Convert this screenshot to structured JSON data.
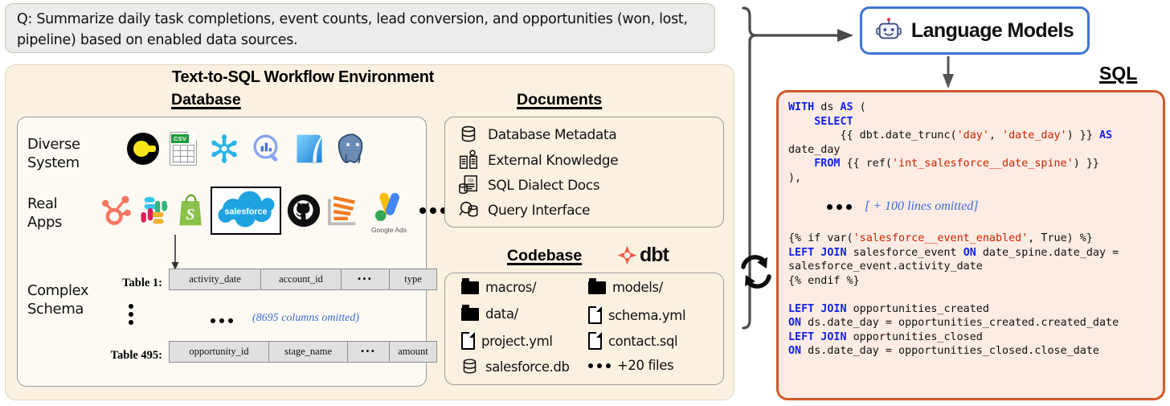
{
  "question": {
    "label": "Q:",
    "text": "Q: Summarize daily task completions, event counts, lead conversion, and opportunities (won, lost, pipeline) based on enabled data sources."
  },
  "environment": {
    "title": "Text-to-SQL Workflow Environment",
    "database": {
      "heading": "Database",
      "rows": [
        {
          "label": "Diverse\nSystem",
          "label_line1": "Diverse",
          "label_line2": "System",
          "icons": [
            "duckdb-icon",
            "csv-file-icon",
            "snowflake-icon",
            "bigquery-icon",
            "sqlite-icon",
            "postgresql-icon"
          ]
        },
        {
          "label": "Real\nApps",
          "label_line1": "Real",
          "label_line2": "Apps",
          "icons": [
            "hubspot-icon",
            "slack-icon",
            "shopify-icon",
            "salesforce-icon",
            "github-icon",
            "asana-icon",
            "google-ads-icon",
            "ellipsis-icon"
          ],
          "salesforce_label": "salesforce",
          "google_ads_label": "Google Ads"
        },
        {
          "label": "Complex\nSchema",
          "label_line1": "Complex",
          "label_line2": "Schema"
        }
      ],
      "tables": [
        {
          "name": "Table 1:",
          "columns": [
            "activity_date",
            "account_id",
            "•••",
            "type"
          ]
        },
        {
          "name": "Table 495:",
          "columns": [
            "opportunity_id",
            "stage_name",
            "•••",
            "amount"
          ]
        }
      ],
      "omitted_note": "(8695 columns omitted)"
    },
    "documents": {
      "heading": "Documents",
      "items": [
        {
          "icon": "database-cylinder-icon",
          "label": "Database Metadata"
        },
        {
          "icon": "open-book-bulb-icon",
          "label": "External Knowledge"
        },
        {
          "icon": "sql-doc-icon",
          "label": "SQL Dialect Docs"
        },
        {
          "icon": "magnifier-database-icon",
          "label": "Query Interface"
        }
      ]
    },
    "codebase": {
      "heading": "Codebase",
      "logo_label": "dbt",
      "items_left": [
        {
          "icon": "folder-icon",
          "label": "macros/"
        },
        {
          "icon": "folder-icon",
          "label": "data/"
        },
        {
          "icon": "file-icon",
          "label": "project.yml"
        },
        {
          "icon": "database-cylinder-icon",
          "label": "salesforce.db"
        }
      ],
      "items_right": [
        {
          "icon": "folder-icon",
          "label": "models/"
        },
        {
          "icon": "file-icon",
          "label": "schema.yml"
        },
        {
          "icon": "file-icon",
          "label": "contact.sql"
        },
        {
          "icon": "ellipsis-icon",
          "label": "+20 files"
        }
      ]
    }
  },
  "language_models": {
    "label": "Language Models",
    "icon": "robot-icon",
    "border_color": "#3E74D6"
  },
  "sql_output": {
    "label": "SQL",
    "border_color": "#D4582A",
    "background_color": "#FDECE3",
    "block_top": "WITH ds AS (\n    SELECT\n        {{ dbt.date_trunc('day', 'date_day') }} AS date_day\n    FROM {{ ref('int_salesforce__date_spine') }}\n),",
    "omitted_note": "[ + 100 lines omitted]",
    "block_bottom": "{% if var('salesforce__event_enabled', True) %}\nLEFT JOIN salesforce_event ON date_spine.date_day = salesforce_event.activity_date\n{% endif %}\n\nLEFT JOIN opportunities_created\nON ds.date_day = opportunities_created.created_date\nLEFT JOIN opportunities_closed\nON ds.date_day = opportunities_closed.close_date"
  },
  "loop_icon": "refresh-loop-icon"
}
